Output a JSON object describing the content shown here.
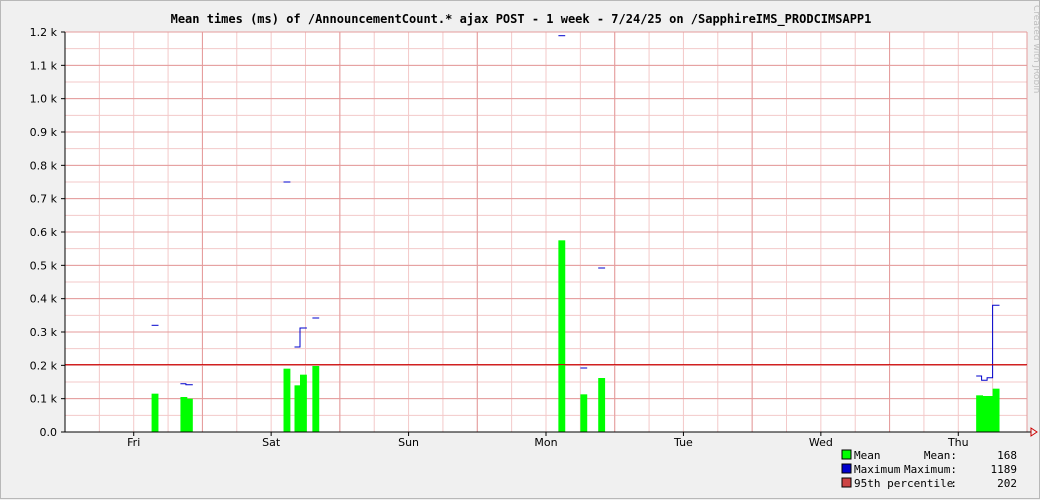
{
  "chart_data": {
    "type": "bar",
    "title": "Mean times (ms) of /AnnouncementCount.* ajax POST - 1 week - 7/24/25 on /SapphireIMS_PRODCIMSAPP1",
    "credit": "Created with JRobin",
    "ylim": [
      0,
      1200
    ],
    "y_ticks": [
      {
        "value": 0,
        "label": "0.0"
      },
      {
        "value": 100,
        "label": "0.1 k"
      },
      {
        "value": 200,
        "label": "0.2 k"
      },
      {
        "value": 300,
        "label": "0.3 k"
      },
      {
        "value": 400,
        "label": "0.4 k"
      },
      {
        "value": 500,
        "label": "0.5 k"
      },
      {
        "value": 600,
        "label": "0.6 k"
      },
      {
        "value": 700,
        "label": "0.7 k"
      },
      {
        "value": 800,
        "label": "0.8 k"
      },
      {
        "value": 900,
        "label": "0.9 k"
      },
      {
        "value": 1000,
        "label": "1.0 k"
      },
      {
        "value": 1100,
        "label": "1.1 k"
      },
      {
        "value": 1200,
        "label": "1.2 k"
      }
    ],
    "x_unit": "days",
    "xlim": [
      0,
      7
    ],
    "x_ticks": [
      {
        "label": "Fri",
        "value": 0.5
      },
      {
        "label": "Sat",
        "value": 1.5
      },
      {
        "label": "Sun",
        "value": 2.5
      },
      {
        "label": "Mon",
        "value": 3.5
      },
      {
        "label": "Tue",
        "value": 4.5
      },
      {
        "label": "Wed",
        "value": 5.5
      },
      {
        "label": "Thu",
        "value": 6.5
      }
    ],
    "series": [
      {
        "name": "Mean",
        "color": "#00ff00",
        "points": [
          {
            "x": 0.63,
            "w": 0.05,
            "y": 115
          },
          {
            "x": 0.84,
            "w": 0.05,
            "y": 105
          },
          {
            "x": 0.88,
            "w": 0.05,
            "y": 100
          },
          {
            "x": 1.59,
            "w": 0.05,
            "y": 190
          },
          {
            "x": 1.67,
            "w": 0.05,
            "y": 140
          },
          {
            "x": 1.71,
            "w": 0.05,
            "y": 172
          },
          {
            "x": 1.8,
            "w": 0.05,
            "y": 198
          },
          {
            "x": 3.59,
            "w": 0.05,
            "y": 575
          },
          {
            "x": 3.75,
            "w": 0.05,
            "y": 113
          },
          {
            "x": 3.88,
            "w": 0.05,
            "y": 162
          },
          {
            "x": 6.63,
            "w": 0.05,
            "y": 110
          },
          {
            "x": 6.67,
            "w": 0.05,
            "y": 108
          },
          {
            "x": 6.71,
            "w": 0.05,
            "y": 108
          },
          {
            "x": 6.75,
            "w": 0.05,
            "y": 130
          }
        ]
      },
      {
        "name": "Maximum",
        "color": "#0000cc",
        "segments": [
          [
            [
              0.63,
              320
            ],
            [
              0.68,
              320
            ]
          ],
          [
            [
              0.84,
              145
            ],
            [
              0.88,
              145
            ],
            [
              0.88,
              142
            ],
            [
              0.93,
              142
            ]
          ],
          [
            [
              1.59,
              750
            ],
            [
              1.64,
              750
            ]
          ],
          [
            [
              1.67,
              255
            ],
            [
              1.71,
              255
            ],
            [
              1.71,
              312
            ],
            [
              1.76,
              312
            ]
          ],
          [
            [
              1.8,
              342
            ],
            [
              1.85,
              342
            ]
          ],
          [
            [
              3.59,
              1189
            ],
            [
              3.64,
              1189
            ]
          ],
          [
            [
              3.75,
              192
            ],
            [
              3.8,
              192
            ]
          ],
          [
            [
              3.88,
              492
            ],
            [
              3.93,
              492
            ]
          ],
          [
            [
              6.63,
              168
            ],
            [
              6.67,
              168
            ],
            [
              6.67,
              155
            ],
            [
              6.71,
              155
            ],
            [
              6.71,
              163
            ],
            [
              6.75,
              163
            ],
            [
              6.75,
              380
            ],
            [
              6.8,
              380
            ]
          ]
        ]
      }
    ],
    "percentile95": {
      "name": "95th percentile",
      "value": 202,
      "color": "#cc0000"
    },
    "legend": [
      {
        "name": "Mean",
        "color": "#00ff00",
        "stat_label": "Mean:",
        "stat_value": "168"
      },
      {
        "name": "Maximum",
        "color": "#0000cc",
        "stat_label": "Maximum:",
        "stat_value": "1189"
      },
      {
        "name": "95th percentile",
        "color": "#cc4444",
        "stat_label": ":",
        "stat_value": "202"
      }
    ],
    "legend_position": "bottom-right",
    "grid": true
  }
}
